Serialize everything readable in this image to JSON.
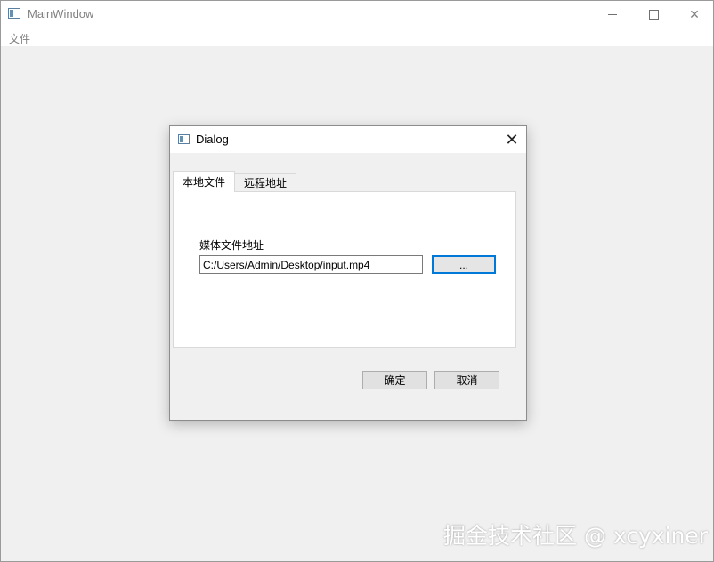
{
  "main_window": {
    "title": "MainWindow",
    "menu": [
      "文件"
    ],
    "controls": {
      "minimize": "minimize-icon",
      "maximize": "maximize-icon",
      "close": "close-icon"
    }
  },
  "dialog": {
    "title": "Dialog",
    "close_glyph": "✕",
    "tabs": [
      {
        "label": "本地文件",
        "active": true
      },
      {
        "label": "远程地址",
        "active": false
      }
    ],
    "field_label": "媒体文件地址",
    "path_value": "C:/Users/Admin/Desktop/input.mp4",
    "browse_label": "...",
    "ok_label": "确定",
    "cancel_label": "取消"
  },
  "watermark": "掘金技术社区 @ xcyxiner",
  "colors": {
    "accent": "#0078d7",
    "background": "#f0f0f0"
  }
}
